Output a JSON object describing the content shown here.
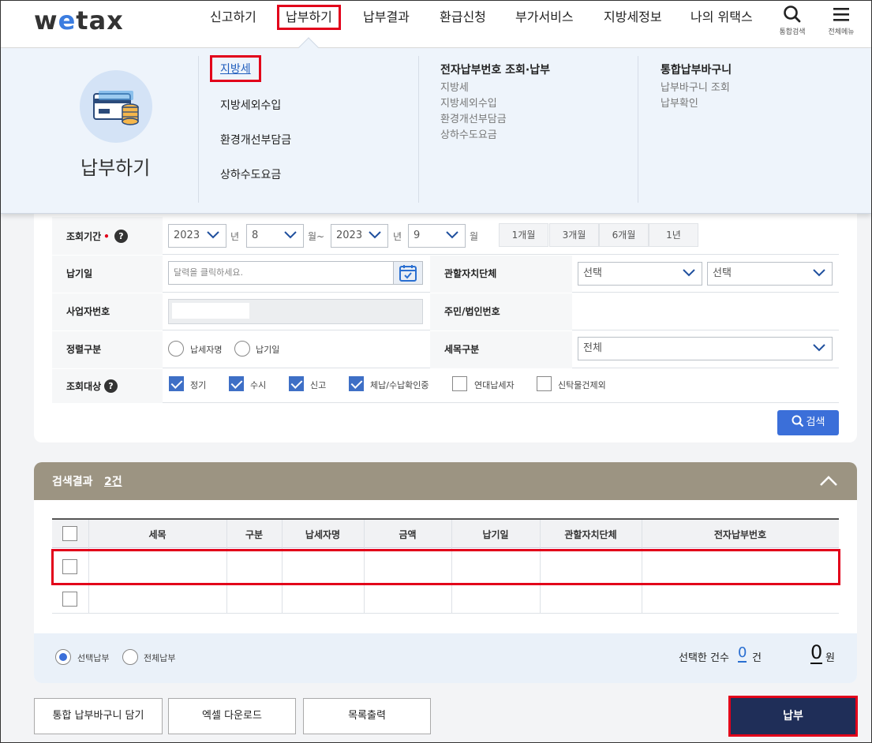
{
  "header": {
    "logo_text_w": "w",
    "logo_text_e": "e",
    "logo_text_rest": "tax",
    "nav": [
      "신고하기",
      "납부하기",
      "납부결과",
      "환급신청",
      "부가서비스",
      "지방세정보",
      "나의 위택스"
    ],
    "util_search_label": "통합검색",
    "util_menu_label": "전체메뉴"
  },
  "mega_menu": {
    "title": "납부하기",
    "col1": [
      "지방세",
      "지방세외수입",
      "환경개선부담금",
      "상하수도요금"
    ],
    "col2_title": "전자납부번호 조회·납부",
    "col2": [
      "지방세",
      "지방세외수입",
      "환경개선부담금",
      "상하수도요금"
    ],
    "col3_title": "통합납부바구니",
    "col3": [
      "납부바구니 조회",
      "납부확인"
    ]
  },
  "search": {
    "period_label": "조회기간",
    "required_mark": "•",
    "year_from": "2023",
    "year_unit": "년",
    "month_from": "8",
    "month_tilde": "월~",
    "year_to": "2023",
    "month_to": "9",
    "month_unit": "월",
    "period_buttons": [
      "1개월",
      "3개월",
      "6개월",
      "1년"
    ],
    "paydate_label": "납기일",
    "paydate_placeholder": "달력을 클릭하세요.",
    "gov_label": "관할자치단체",
    "gov_select1": "선택",
    "gov_select2": "선택",
    "bizno_label": "사업자번호",
    "resno_label": "주민/법인번호",
    "sort_label": "정렬구분",
    "sort_options": [
      "납세자명",
      "납기일"
    ],
    "tax_type_label": "세목구분",
    "tax_type_value": "전체",
    "target_label": "조회대상",
    "target_options": [
      {
        "label": "정기",
        "checked": true
      },
      {
        "label": "수시",
        "checked": true
      },
      {
        "label": "신고",
        "checked": true
      },
      {
        "label": "체납/수납확인중",
        "checked": true
      },
      {
        "label": "연대납세자",
        "checked": false
      },
      {
        "label": "신탁물건제외",
        "checked": false
      }
    ],
    "search_button": "검색"
  },
  "result": {
    "title": "검색결과",
    "count": "2건",
    "columns": [
      "세목",
      "구분",
      "납세자명",
      "금액",
      "납기일",
      "관할자치단체",
      "전자납부번호"
    ],
    "pay_mode_selected": "선택납부",
    "pay_mode_all": "전체납부",
    "selected_count_label": "선택한 건수",
    "selected_count": "0",
    "count_unit": "건",
    "amount": "0",
    "amount_unit": "원"
  },
  "actions": {
    "basket": "통합 납부바구니 담기",
    "excel": "엑셀 다운로드",
    "print": "목록출력",
    "pay": "납부"
  },
  "colors": {
    "accent": "#3b6fd9",
    "highlight": "#e2001a",
    "pay_button": "#1f2e58",
    "result_header": "#9c9482"
  }
}
